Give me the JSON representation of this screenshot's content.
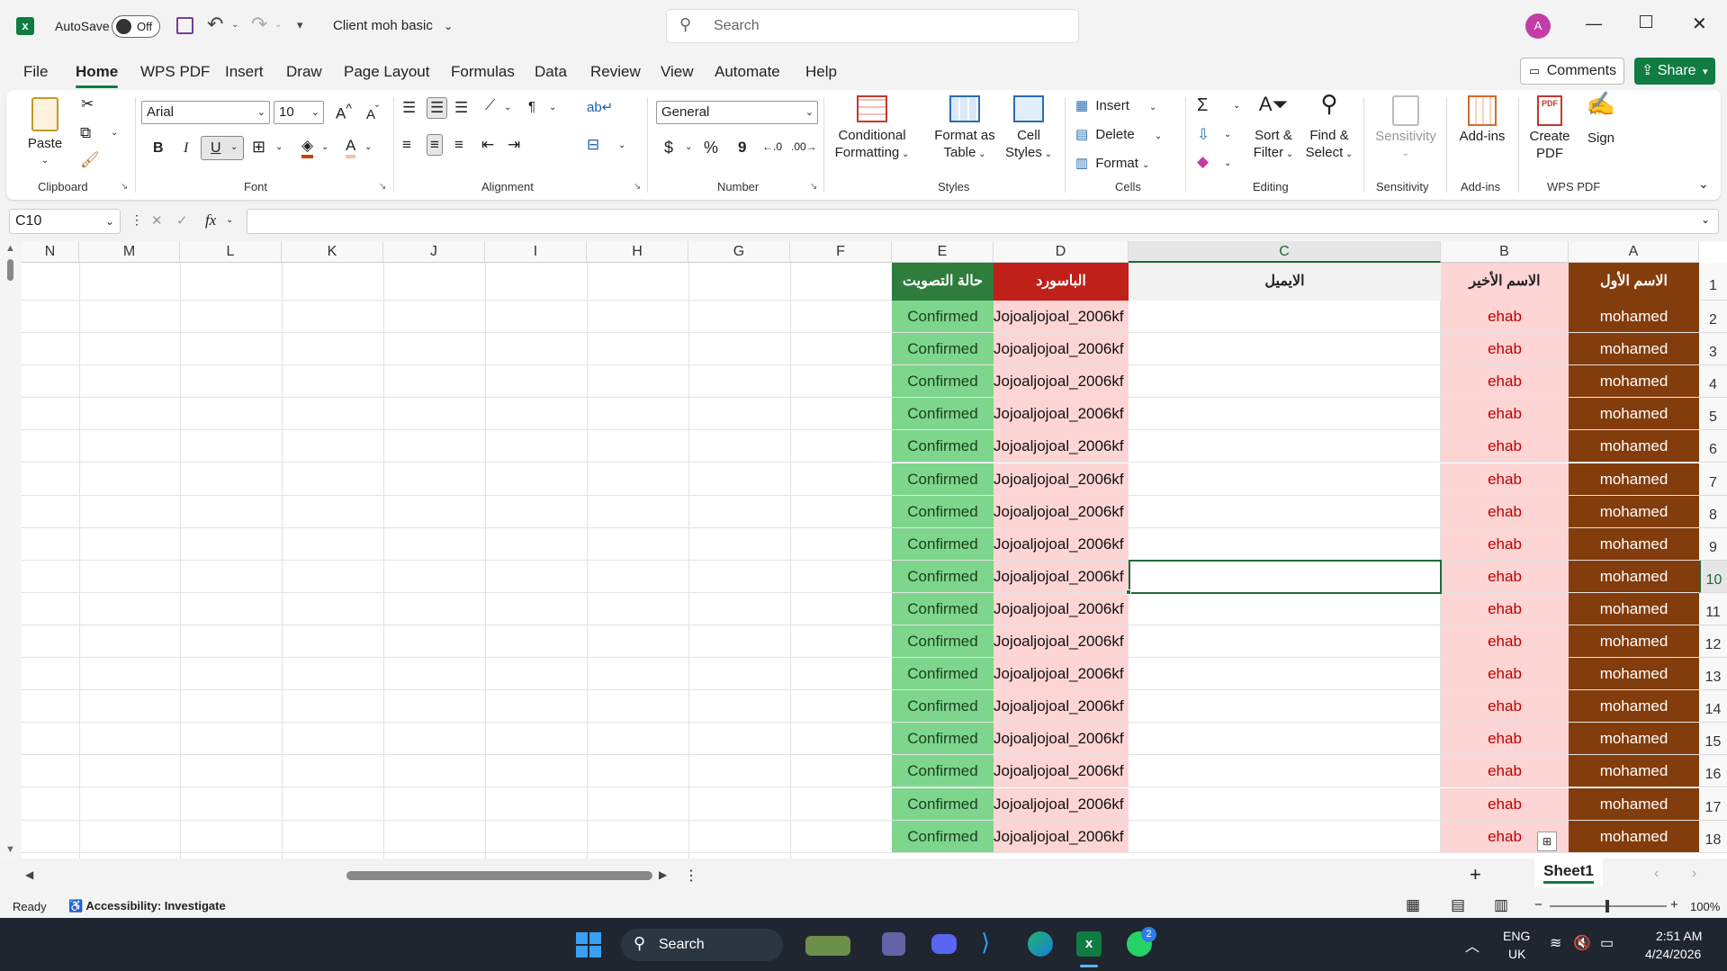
{
  "titlebar": {
    "autosave_label": "AutoSave",
    "autosave_state": "Off",
    "file_name": "Client moh basic",
    "search_placeholder": "Search",
    "avatar_initial": "A"
  },
  "menu": {
    "items": [
      "File",
      "Home",
      "WPS PDF",
      "Insert",
      "Draw",
      "Page Layout",
      "Formulas",
      "Data",
      "Review",
      "View",
      "Automate",
      "Help"
    ],
    "active": "Home",
    "comments_label": "Comments",
    "share_label": "Share"
  },
  "ribbon": {
    "clipboard": {
      "paste": "Paste",
      "label": "Clipboard"
    },
    "font": {
      "family": "Arial",
      "size": "10",
      "label": "Font",
      "bold": "B",
      "italic": "I",
      "underline": "U"
    },
    "alignment": {
      "label": "Alignment"
    },
    "number": {
      "format": "General",
      "label": "Number",
      "currency": "$",
      "percent": "%",
      "comma": "9"
    },
    "styles": {
      "conditional_1": "Conditional",
      "conditional_2": "Formatting",
      "format_table_1": "Format as",
      "format_table_2": "Table",
      "cell_styles_1": "Cell",
      "cell_styles_2": "Styles",
      "label": "Styles"
    },
    "cells": {
      "insert": "Insert",
      "delete": "Delete",
      "format": "Format",
      "label": "Cells"
    },
    "editing": {
      "sort_1": "Sort &",
      "sort_2": "Filter",
      "find_1": "Find &",
      "find_2": "Select",
      "label": "Editing"
    },
    "sensitivity": {
      "btn": "Sensitivity",
      "label": "Sensitivity"
    },
    "addins": {
      "btn": "Add-ins",
      "label": "Add-ins"
    },
    "wpspdf": {
      "create_1": "Create",
      "create_2": "PDF",
      "sign": "Sign",
      "label": "WPS PDF"
    }
  },
  "formula_bar": {
    "name_box": "C10",
    "fx": "fx",
    "content": ""
  },
  "sheet": {
    "columns": [
      "N",
      "M",
      "L",
      "K",
      "J",
      "I",
      "H",
      "G",
      "F",
      "E",
      "D",
      "C",
      "B",
      "A"
    ],
    "headers": {
      "A": "الاسم الأول",
      "B": "الاسم الأخير",
      "C": "الايميل",
      "D": "الباسورد",
      "E": "حالة التصويت"
    },
    "row_numbers": [
      "1",
      "2",
      "3",
      "4",
      "5",
      "6",
      "7",
      "8",
      "9",
      "10",
      "11",
      "12",
      "13",
      "14",
      "15",
      "16",
      "17",
      "18"
    ],
    "rows": [
      {
        "A": "mohamed",
        "B": "ehab",
        "C": "",
        "D": "Jojoaljojoal_2006kf",
        "E": "Confirmed"
      },
      {
        "A": "mohamed",
        "B": "ehab",
        "C": "",
        "D": "Jojoaljojoal_2006kf",
        "E": "Confirmed"
      },
      {
        "A": "mohamed",
        "B": "ehab",
        "C": "",
        "D": "Jojoaljojoal_2006kf",
        "E": "Confirmed"
      },
      {
        "A": "mohamed",
        "B": "ehab",
        "C": "",
        "D": "Jojoaljojoal_2006kf",
        "E": "Confirmed"
      },
      {
        "A": "mohamed",
        "B": "ehab",
        "C": "",
        "D": "Jojoaljojoal_2006kf",
        "E": "Confirmed"
      },
      {
        "A": "mohamed",
        "B": "ehab",
        "C": "",
        "D": "Jojoaljojoal_2006kf",
        "E": "Confirmed"
      },
      {
        "A": "mohamed",
        "B": "ehab",
        "C": "",
        "D": "Jojoaljojoal_2006kf",
        "E": "Confirmed"
      },
      {
        "A": "mohamed",
        "B": "ehab",
        "C": "",
        "D": "Jojoaljojoal_2006kf",
        "E": "Confirmed"
      },
      {
        "A": "mohamed",
        "B": "ehab",
        "C": "",
        "D": "Jojoaljojoal_2006kf",
        "E": "Confirmed"
      },
      {
        "A": "mohamed",
        "B": "ehab",
        "C": "",
        "D": "Jojoaljojoal_2006kf",
        "E": "Confirmed"
      },
      {
        "A": "mohamed",
        "B": "ehab",
        "C": "",
        "D": "Jojoaljojoal_2006kf",
        "E": "Confirmed"
      },
      {
        "A": "mohamed",
        "B": "ehab",
        "C": "",
        "D": "Jojoaljojoal_2006kf",
        "E": "Confirmed"
      },
      {
        "A": "mohamed",
        "B": "ehab",
        "C": "",
        "D": "Jojoaljojoal_2006kf",
        "E": "Confirmed"
      },
      {
        "A": "mohamed",
        "B": "ehab",
        "C": "",
        "D": "Jojoaljojoal_2006kf",
        "E": "Confirmed"
      },
      {
        "A": "mohamed",
        "B": "ehab",
        "C": "",
        "D": "Jojoaljojoal_2006kf",
        "E": "Confirmed"
      },
      {
        "A": "mohamed",
        "B": "ehab",
        "C": "",
        "D": "Jojoaljojoal_2006kf",
        "E": "Confirmed"
      },
      {
        "A": "mohamed",
        "B": "ehab",
        "C": "",
        "D": "Jojoaljojoal_2006kf",
        "E": "Confirmed"
      }
    ],
    "selected_cell": "C10",
    "colors": {
      "A_bg": "#833c0c",
      "A_fg": "#ffffff",
      "B_bg": "#fcd5d4",
      "B_fg": "#c00000",
      "D_bg": "#fcd5d4",
      "D_hdr": "#c0201a",
      "E_bg": "#7dd68c",
      "E_hdr": "#2e7d3c",
      "selection": "#1e6b3a"
    }
  },
  "tabs": {
    "sheet_name": "Sheet1"
  },
  "status": {
    "ready": "Ready",
    "accessibility": "Accessibility: Investigate",
    "zoom": "100%"
  },
  "taskbar": {
    "search": "Search",
    "lang_1": "ENG",
    "lang_2": "UK",
    "time": "2:51 AM",
    "date": "4/24/2026",
    "badge": "2"
  }
}
